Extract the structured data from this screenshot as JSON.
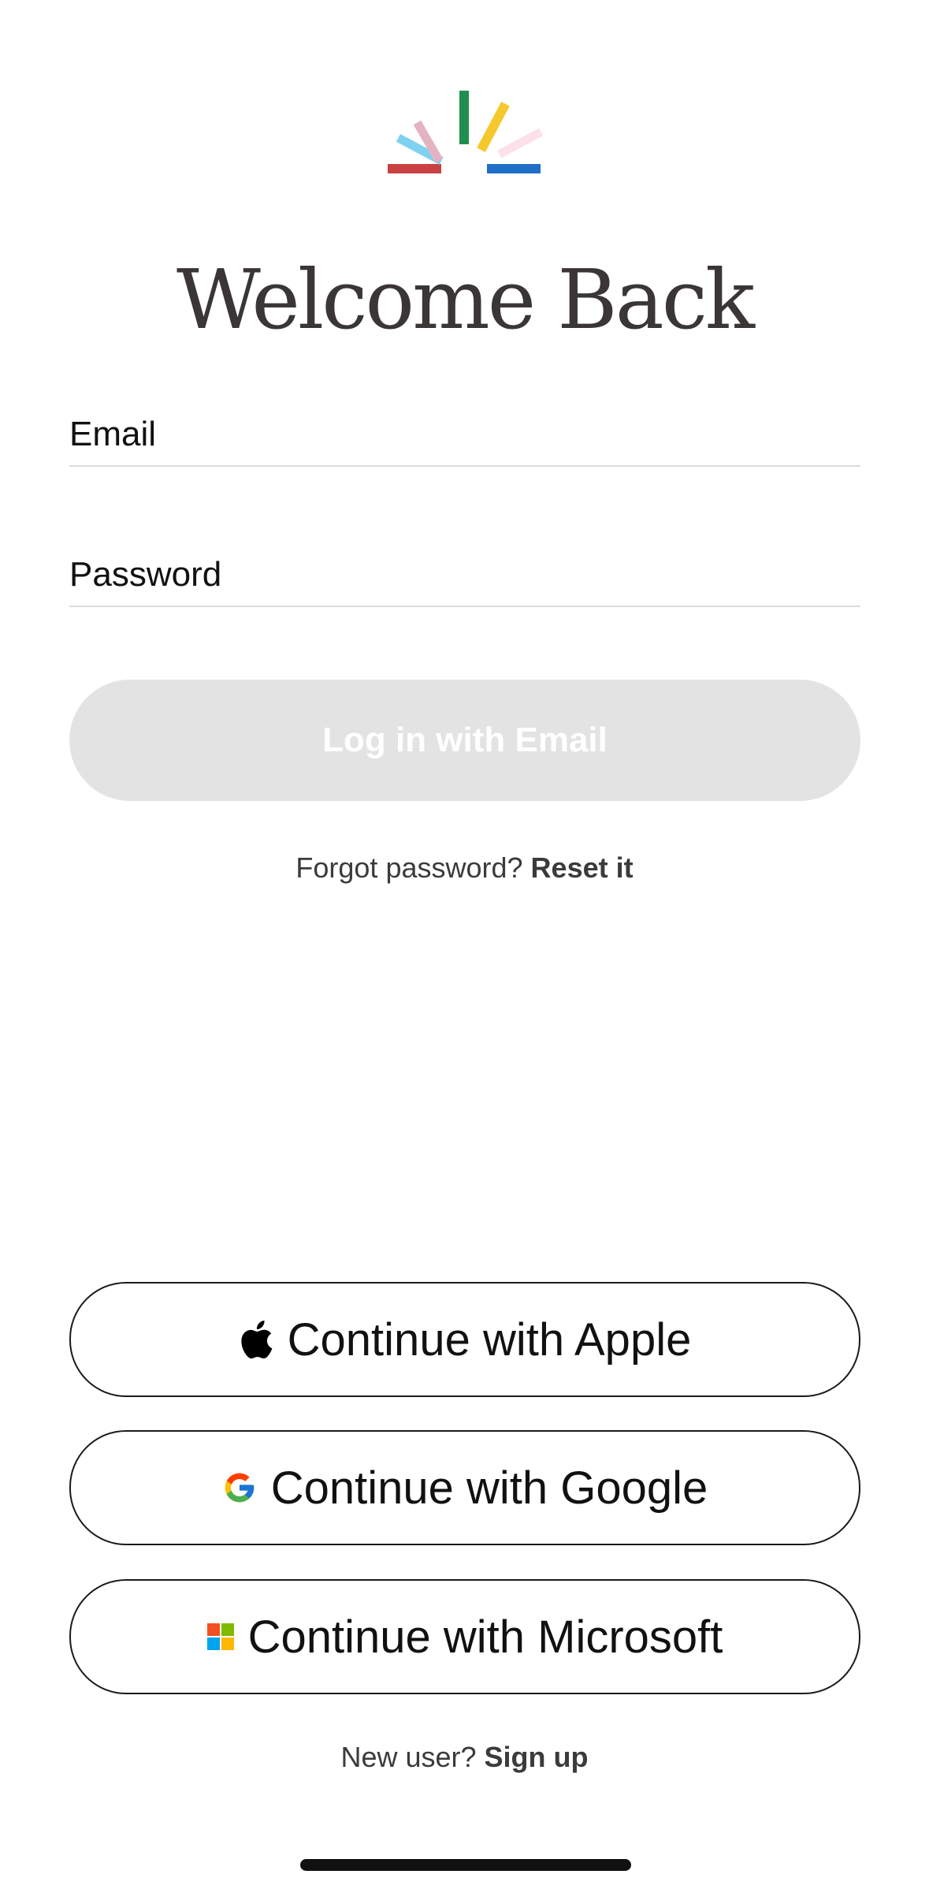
{
  "header": {
    "title": "Welcome Back"
  },
  "form": {
    "email_label": "Email",
    "password_label": "Password",
    "login_button": "Log in with Email",
    "forgot_prompt": "Forgot password?",
    "reset_link": "Reset it"
  },
  "sso": {
    "apple_label": "Continue with Apple",
    "google_label": "Continue with Google",
    "microsoft_label": "Continue with Microsoft"
  },
  "footer": {
    "new_user_prompt": "New user?",
    "signup_link": "Sign up"
  },
  "icons": {
    "logo": "sunburst-logo-icon",
    "apple": "apple-icon",
    "google": "google-icon",
    "microsoft": "microsoft-icon"
  },
  "colors": {
    "title": "#3a3636",
    "login_disabled_bg": "#e3e3e3",
    "logo_rays": [
      "#c94142",
      "#7fd2ef",
      "#e4b3c3",
      "#1f8f4e",
      "#f5c92d",
      "#fde1e8",
      "#1f6fc8"
    ]
  }
}
